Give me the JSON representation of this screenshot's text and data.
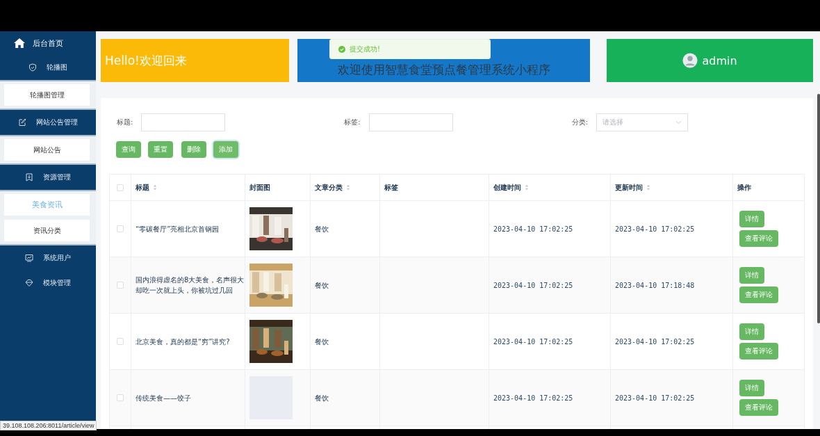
{
  "sidebar": {
    "home": "后台首页",
    "groups": [
      {
        "label": "轮播图",
        "children": [
          {
            "label": "轮播图管理",
            "selected": false
          }
        ]
      },
      {
        "label": "网站公告管理",
        "children": [
          {
            "label": "网站公告",
            "selected": false
          }
        ]
      },
      {
        "label": "资源管理",
        "children": [
          {
            "label": "美食资讯",
            "selected": true
          },
          {
            "label": "资讯分类",
            "selected": false
          }
        ]
      },
      {
        "label": "系统用户"
      },
      {
        "label": "模块管理"
      }
    ]
  },
  "banners": [
    {
      "kind": "greeting",
      "text": "Hello!欢迎回来"
    },
    {
      "kind": "title",
      "text": "欢迎使用智慧食堂预点餐管理系统小程序"
    },
    {
      "kind": "user",
      "text": "admin"
    }
  ],
  "toast": {
    "text": "提交成功!"
  },
  "filters": [
    {
      "kind": "input",
      "label": "标题:"
    },
    {
      "kind": "input",
      "label": "标签:"
    },
    {
      "kind": "select",
      "label": "分类:",
      "placeholder": "请选择"
    }
  ],
  "buttons": [
    {
      "label": "查询",
      "focused": false
    },
    {
      "label": "重置",
      "focused": false
    },
    {
      "label": "删除",
      "focused": false
    },
    {
      "label": "添加",
      "focused": true
    }
  ],
  "table": {
    "all_checked": false,
    "columns": [
      {
        "label": "标题",
        "sortable": true
      },
      {
        "label": "封面图",
        "sortable": false
      },
      {
        "label": "文章分类",
        "sortable": true
      },
      {
        "label": "标签",
        "sortable": false
      },
      {
        "label": "创建时间",
        "sortable": true
      },
      {
        "label": "更新时间",
        "sortable": true
      },
      {
        "label": "操作",
        "sortable": false
      }
    ],
    "rows": [
      {
        "checked": false,
        "title": "“零碳餐厅”亮相北京首钢园",
        "cover": {
          "kind": "picture"
        },
        "category": "餐饮",
        "created": "2023-04-10 17:02:25",
        "updated": "2023-04-10 17:02:25",
        "actions": [
          "详情",
          "查看评论"
        ]
      },
      {
        "checked": false,
        "title": "国内浪得虚名的8大美食，名声很大却吃一次就上头，你被坑过几回",
        "cover": {
          "kind": "picture"
        },
        "category": "餐饮",
        "created": "2023-04-10 17:02:25",
        "updated": "2023-04-10 17:18:48",
        "actions": [
          "详情",
          "查看评论"
        ]
      },
      {
        "checked": false,
        "title": "北京美食，真的都是“穷”讲究?",
        "cover": {
          "kind": "picture"
        },
        "category": "餐饮",
        "created": "2023-04-10 17:02:25",
        "updated": "2023-04-10 17:02:25",
        "actions": [
          "详情",
          "查看评论"
        ]
      },
      {
        "checked": false,
        "title": "传统美食——饺子",
        "cover": {
          "kind": "empty"
        },
        "category": "餐饮",
        "created": "2023-04-10 17:02:25",
        "updated": "2023-04-10 17:02:25",
        "actions": [
          "详情",
          "查看评论"
        ]
      }
    ]
  },
  "status_url": "39.108.108.206:8011/article/view"
}
